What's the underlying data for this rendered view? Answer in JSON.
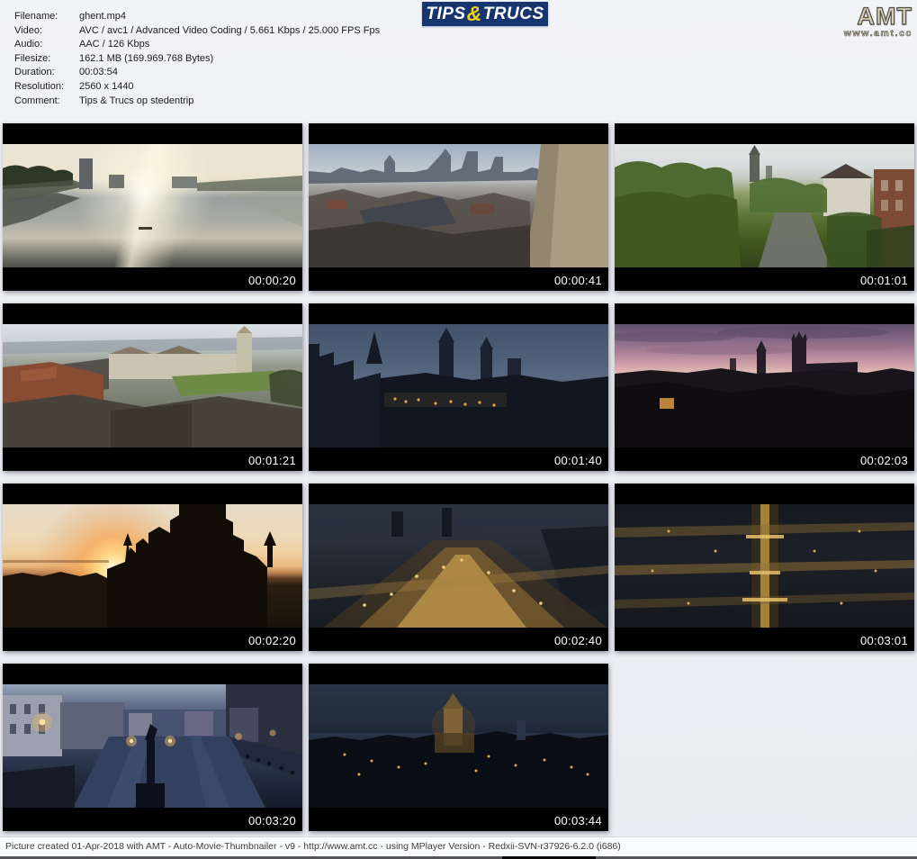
{
  "metadata": {
    "rows": [
      {
        "label": "Filename:",
        "value": "ghent.mp4"
      },
      {
        "label": "Video:",
        "value": "AVC / avc1 / Advanced Video Coding / 5.661 Kbps / 25.000 FPS Fps"
      },
      {
        "label": "Audio:",
        "value": "AAC / 126 Kbps"
      },
      {
        "label": "Filesize:",
        "value": "162.1 MB (169.969.768 Bytes)"
      },
      {
        "label": "Duration:",
        "value": "00:03:54"
      },
      {
        "label": "Resolution:",
        "value": "2560 x 1440"
      },
      {
        "label": "Comment:",
        "value": "Tips & Trucs op stedentrip"
      }
    ]
  },
  "logo_tips_trucs": {
    "part1": "TIPS",
    "amp": "&",
    "part2": "TRUCS",
    "bg_color": "#16356f",
    "amp_color": "#f2d211"
  },
  "logo_amt": {
    "title": "AMT",
    "subtitle": "www.amt.cc"
  },
  "thumbnails": [
    {
      "time": "00:00:20"
    },
    {
      "time": "00:00:41"
    },
    {
      "time": "00:01:01"
    },
    {
      "time": "00:01:21"
    },
    {
      "time": "00:01:40"
    },
    {
      "time": "00:02:03"
    },
    {
      "time": "00:02:20"
    },
    {
      "time": "00:02:40"
    },
    {
      "time": "00:03:01"
    },
    {
      "time": "00:03:20"
    },
    {
      "time": "00:03:44"
    }
  ],
  "footer": {
    "text": "Picture created 01-Apr-2018 with AMT - Auto-Movie-Thumbnailer - v9 - http://www.amt.cc - using MPlayer Version - Redxii-SVN-r37926-6.2.0 (i686)"
  },
  "colors": {
    "timestamp": "#ffffff",
    "background": "#eceef2",
    "logo_navy": "#16356f",
    "logo_yellow": "#f2d211"
  }
}
